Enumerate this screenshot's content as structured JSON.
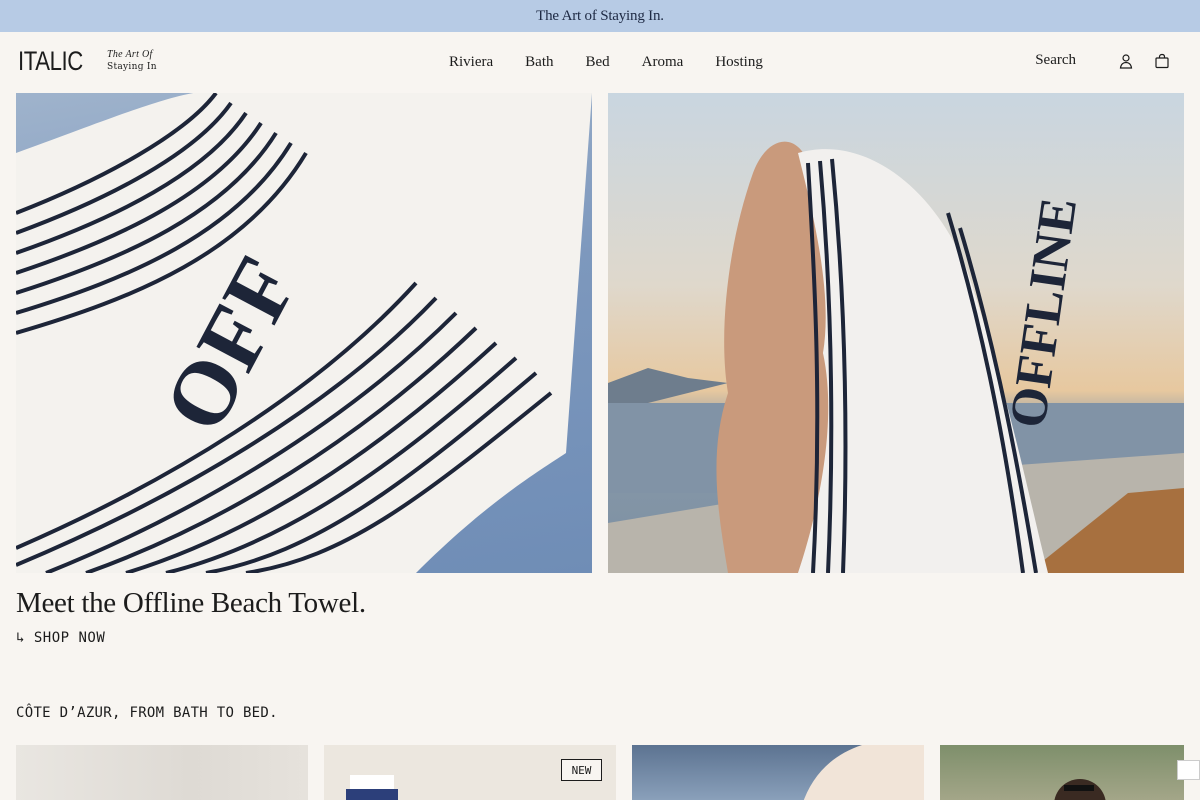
{
  "announcement": {
    "text": "The Art of Staying In."
  },
  "brand": {
    "name": "ITALIC",
    "tagline_1": "The Art Of",
    "tagline_2": "Staying In"
  },
  "nav": {
    "items": [
      {
        "label": "Riviera"
      },
      {
        "label": "Bath"
      },
      {
        "label": "Bed"
      },
      {
        "label": "Aroma"
      },
      {
        "label": "Hosting"
      }
    ]
  },
  "tools": {
    "search_label": "Search",
    "account_icon": "user-icon",
    "cart_icon": "bag-icon"
  },
  "hero": {
    "left_image_text": "OFF",
    "right_image_text": "OFFLINE",
    "title": "Meet the Offline Beach Towel.",
    "cta": "↳ SHOP NOW"
  },
  "collection": {
    "title": "CÔTE D’AZUR, FROM BATH TO BED.",
    "cards": [
      {
        "badge": ""
      },
      {
        "badge": "NEW"
      },
      {
        "badge": ""
      },
      {
        "badge": ""
      }
    ]
  },
  "colors": {
    "announcement_bg": "#b7cbe5",
    "page_bg": "#f8f5f1",
    "navy": "#1e2a44"
  }
}
